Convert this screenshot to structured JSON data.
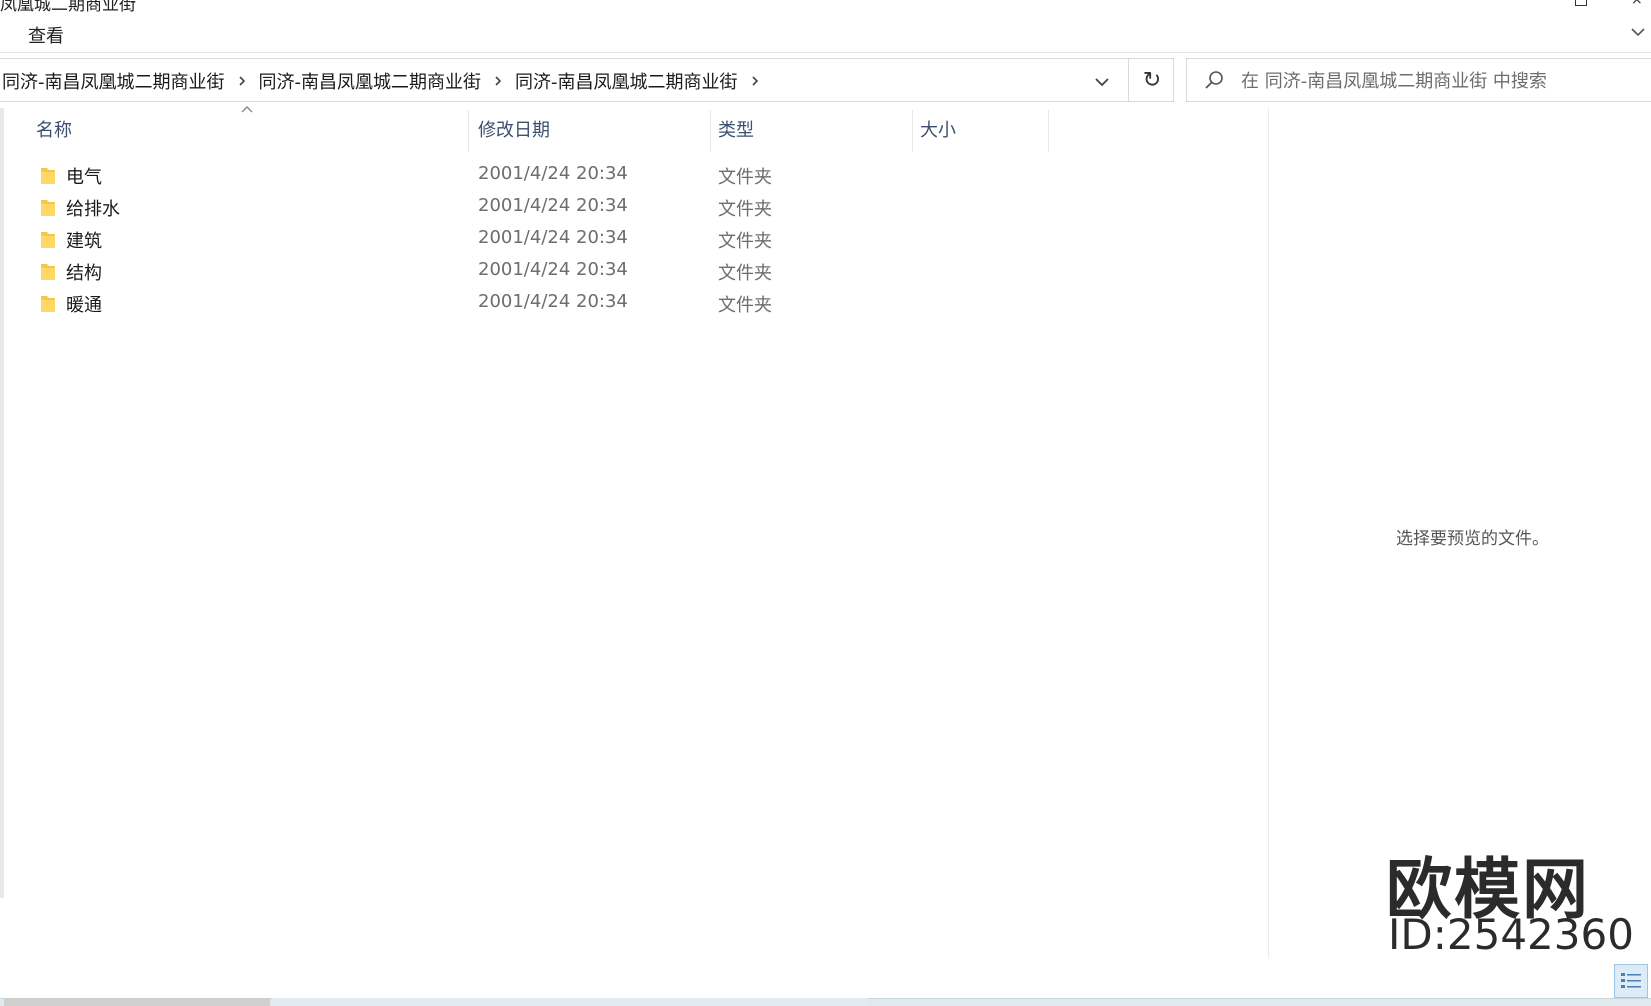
{
  "window": {
    "title": "凤凰城二期商业街"
  },
  "ribbon": {
    "view_tab": "查看"
  },
  "address_bar": {
    "crumbs": [
      "同济-南昌凤凰城二期商业街",
      "同济-南昌凤凰城二期商业街",
      "同济-南昌凤凰城二期商业街"
    ]
  },
  "search": {
    "placeholder": "在 同济-南昌凤凰城二期商业街 中搜索"
  },
  "columns": {
    "name": "名称",
    "date": "修改日期",
    "type": "类型",
    "size": "大小"
  },
  "files": [
    {
      "name": "电气",
      "date": "2001/4/24 20:34",
      "type": "文件夹"
    },
    {
      "name": "给排水",
      "date": "2001/4/24 20:34",
      "type": "文件夹"
    },
    {
      "name": "建筑",
      "date": "2001/4/24 20:34",
      "type": "文件夹"
    },
    {
      "name": "结构",
      "date": "2001/4/24 20:34",
      "type": "文件夹"
    },
    {
      "name": "暖通",
      "date": "2001/4/24 20:34",
      "type": "文件夹"
    }
  ],
  "preview": {
    "message": "选择要预览的文件。"
  },
  "watermark": {
    "brand": "欧模网",
    "id_text": "ID:2542360"
  },
  "icons": {
    "folder": "folder-icon",
    "search": "search-icon",
    "refresh": "refresh-icon",
    "chevron": "chevron-right-icon"
  },
  "colors": {
    "folder_yellow": "#f5c84c",
    "header_text": "#3d4f6e",
    "muted_text": "#6d6d6d"
  }
}
